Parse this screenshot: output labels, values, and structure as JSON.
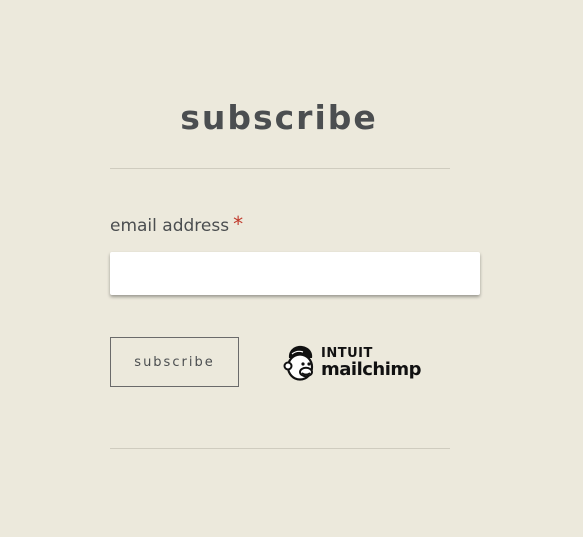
{
  "form": {
    "title": "subscribe",
    "email_label": "email address",
    "required_marker": "*",
    "email_value": "",
    "submit_label": "subscribe"
  },
  "badge": {
    "brand_line1": "INTUIT",
    "brand_line2": "mailchimp",
    "icon": "mailchimp-freddie-icon"
  },
  "colors": {
    "background": "#ece9dc",
    "text": "#4b4e50",
    "required": "#c0392b",
    "input_bg": "#ffffff"
  }
}
